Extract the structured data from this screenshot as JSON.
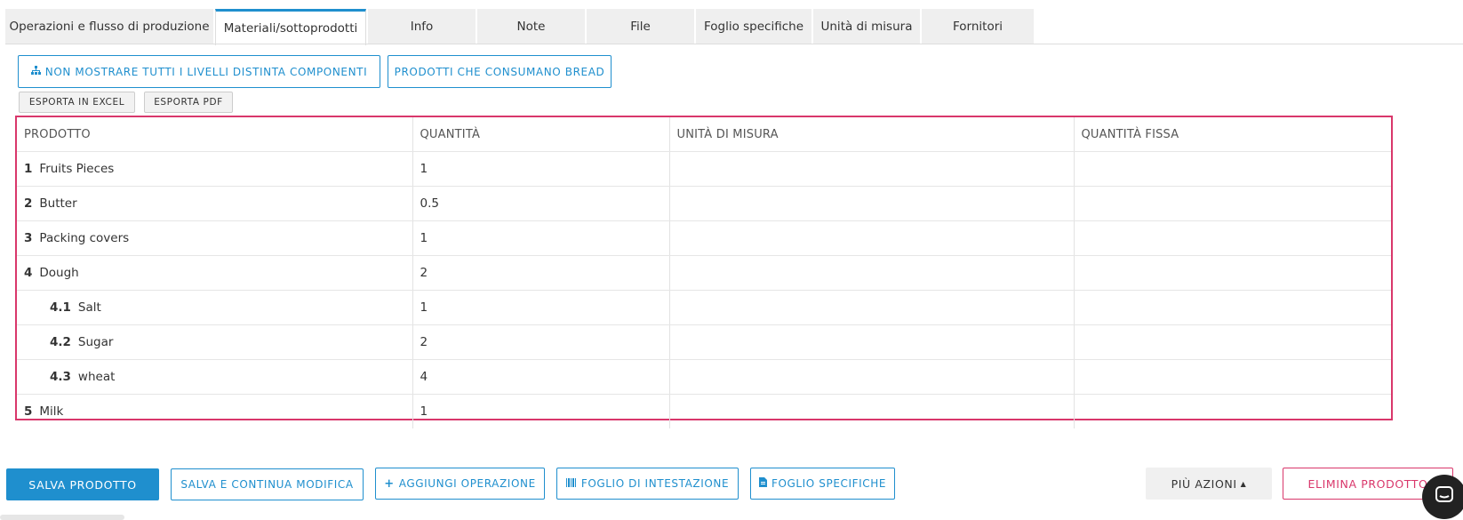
{
  "tabs": [
    "Operazioni e flusso di produzione",
    "Materiali/sottoprodotti",
    "Info",
    "Note",
    "File",
    "Foglio specifiche",
    "Unità di misura",
    "Fornitori"
  ],
  "active_tab": "Materiali/sottoprodotti",
  "toolbar": {
    "levels_label": "NON MOSTRARE TUTTI I LIVELLI DISTINTA COMPONENTI",
    "consumers_label": "PRODOTTI CHE CONSUMANO BREAD",
    "export_excel": "ESPORTA IN EXCEL",
    "export_pdf": "ESPORTA PDF"
  },
  "table": {
    "headers": [
      "PRODOTTO",
      "QUANTITÀ",
      "UNITÀ DI MISURA",
      "QUANTITÀ FISSA"
    ],
    "rows": [
      {
        "num": "1",
        "name": "Fruits Pieces",
        "qty": "1",
        "uom": "",
        "fixed": ""
      },
      {
        "num": "2",
        "name": "Butter",
        "qty": "0.5",
        "uom": "",
        "fixed": ""
      },
      {
        "num": "3",
        "name": "Packing covers",
        "qty": "1",
        "uom": "",
        "fixed": ""
      },
      {
        "num": "4",
        "name": "Dough",
        "qty": "2",
        "uom": "",
        "fixed": ""
      },
      {
        "num": "4.1",
        "name": "Salt",
        "qty": "1",
        "uom": "",
        "fixed": ""
      },
      {
        "num": "4.2",
        "name": "Sugar",
        "qty": "2",
        "uom": "",
        "fixed": ""
      },
      {
        "num": "4.3",
        "name": "wheat",
        "qty": "4",
        "uom": "",
        "fixed": ""
      },
      {
        "num": "5",
        "name": "Milk",
        "qty": "1",
        "uom": "",
        "fixed": ""
      }
    ]
  },
  "actions": {
    "save": "SALVA PRODOTTO",
    "save_continue": "SALVA E CONTINUA MODIFICA",
    "add_operation": "AGGIUNGI OPERAZIONE",
    "header_sheet": "FOGLIO DI INTESTAZIONE",
    "spec_sheet": "FOGLIO SPECIFICHE",
    "more_actions": "PIÙ AZIONI",
    "delete": "ELIMINA PRODOTTO"
  },
  "colors": {
    "accent": "#1f8fce",
    "highlight": "#d9376b"
  }
}
